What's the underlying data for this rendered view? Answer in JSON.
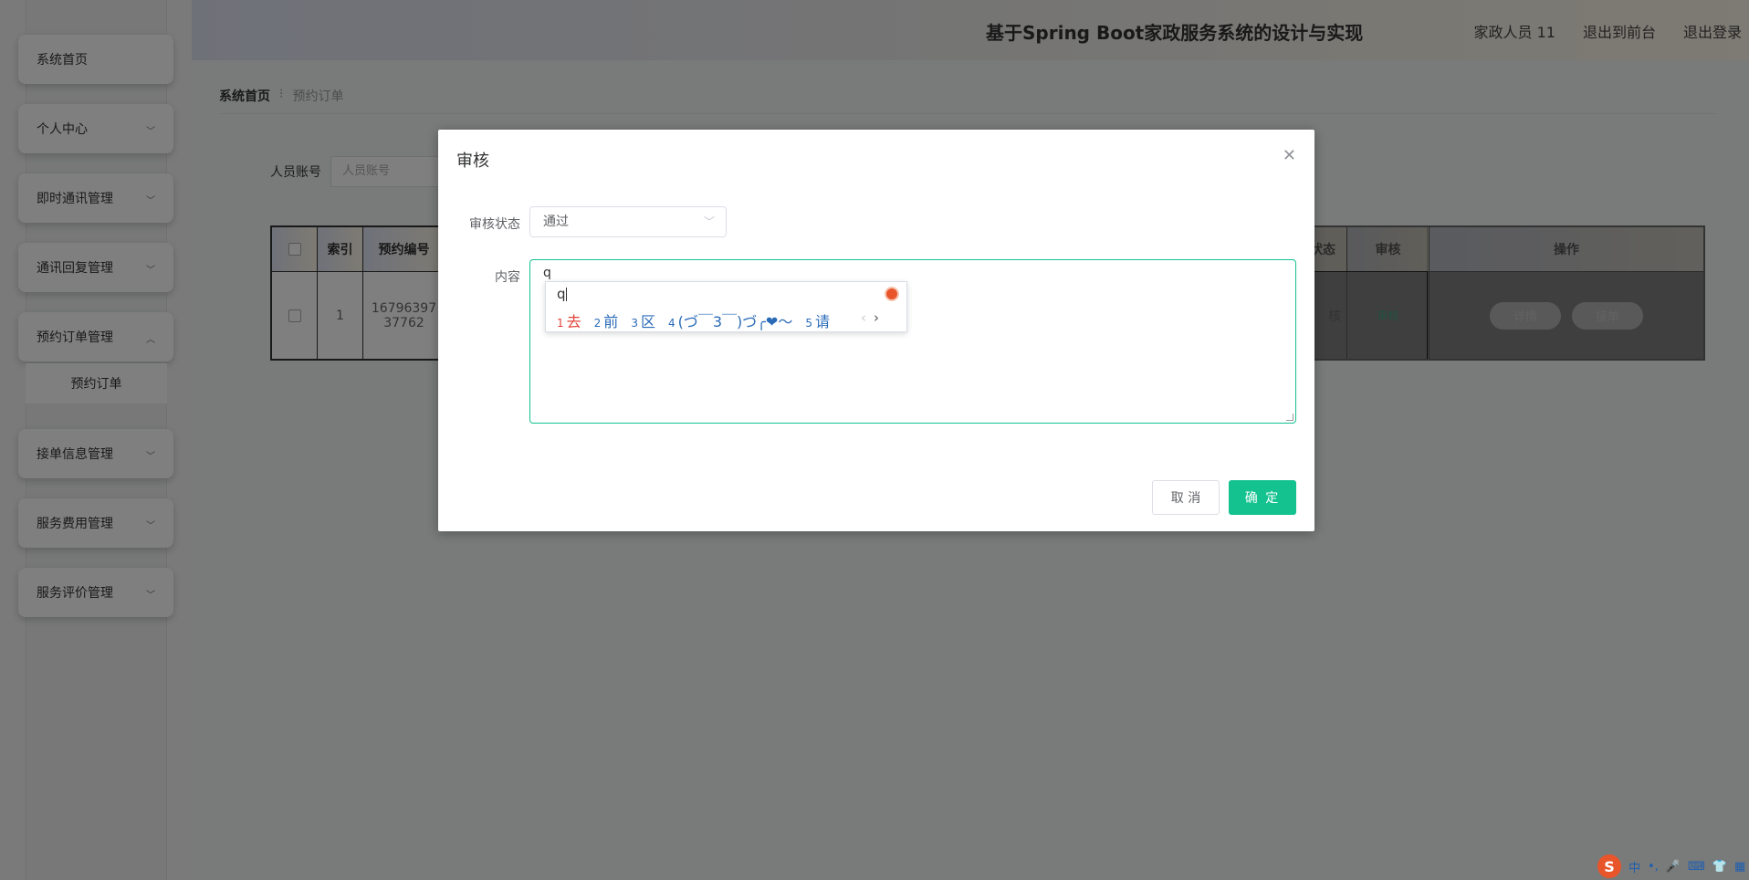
{
  "sidebar": {
    "items": [
      {
        "label": "系统首页"
      },
      {
        "label": "个人中心"
      },
      {
        "label": "即时通讯管理"
      },
      {
        "label": "通讯回复管理"
      },
      {
        "label": "预约订单管理"
      },
      {
        "label": "接单信息管理"
      },
      {
        "label": "服务费用管理"
      },
      {
        "label": "服务评价管理"
      }
    ],
    "submenu": {
      "label": "预约订单"
    }
  },
  "header": {
    "title": "基于Spring Boot家政服务系统的设计与实现",
    "user": "家政人员 11",
    "front": "退出到前台",
    "logout": "退出登录"
  },
  "breadcrumb": {
    "home": "系统首页",
    "sep": "⁝",
    "current": "预约订单"
  },
  "search": {
    "label": "人员账号",
    "placeholder": "人员账号"
  },
  "table": {
    "headers": [
      "索引",
      "预约编号",
      "状态",
      "审核",
      "操作"
    ],
    "row": {
      "index": "1",
      "order_no_line1": "16796397",
      "order_no_line2": "37762",
      "status": "核",
      "audit": "审核",
      "btn_detail": "详情",
      "btn_accept": "接单"
    }
  },
  "dialog": {
    "title": "审核",
    "status_label": "审核状态",
    "status_value": "通过",
    "content_label": "内容",
    "content_value": "q",
    "cancel": "取 消",
    "ok": "确 定"
  },
  "ime": {
    "input": "q",
    "candidates": [
      {
        "num": "1",
        "text": "去"
      },
      {
        "num": "2",
        "text": "前"
      },
      {
        "num": "3",
        "text": "区"
      },
      {
        "num": "4",
        "text": "(づ￣3￣)づ╭❤～"
      },
      {
        "num": "5",
        "text": "请"
      }
    ],
    "nav_prev": "‹",
    "nav_next": "›"
  },
  "tray": {
    "logo": "S",
    "mode": "中",
    "punct": "•,",
    "mic": "🎤",
    "kbd": "⌨",
    "shirt": "👕",
    "grid": "▦"
  },
  "colors": {
    "accent": "#13c28f",
    "ime_red": "#e0433a",
    "ime_blue": "#2a6bb8"
  }
}
